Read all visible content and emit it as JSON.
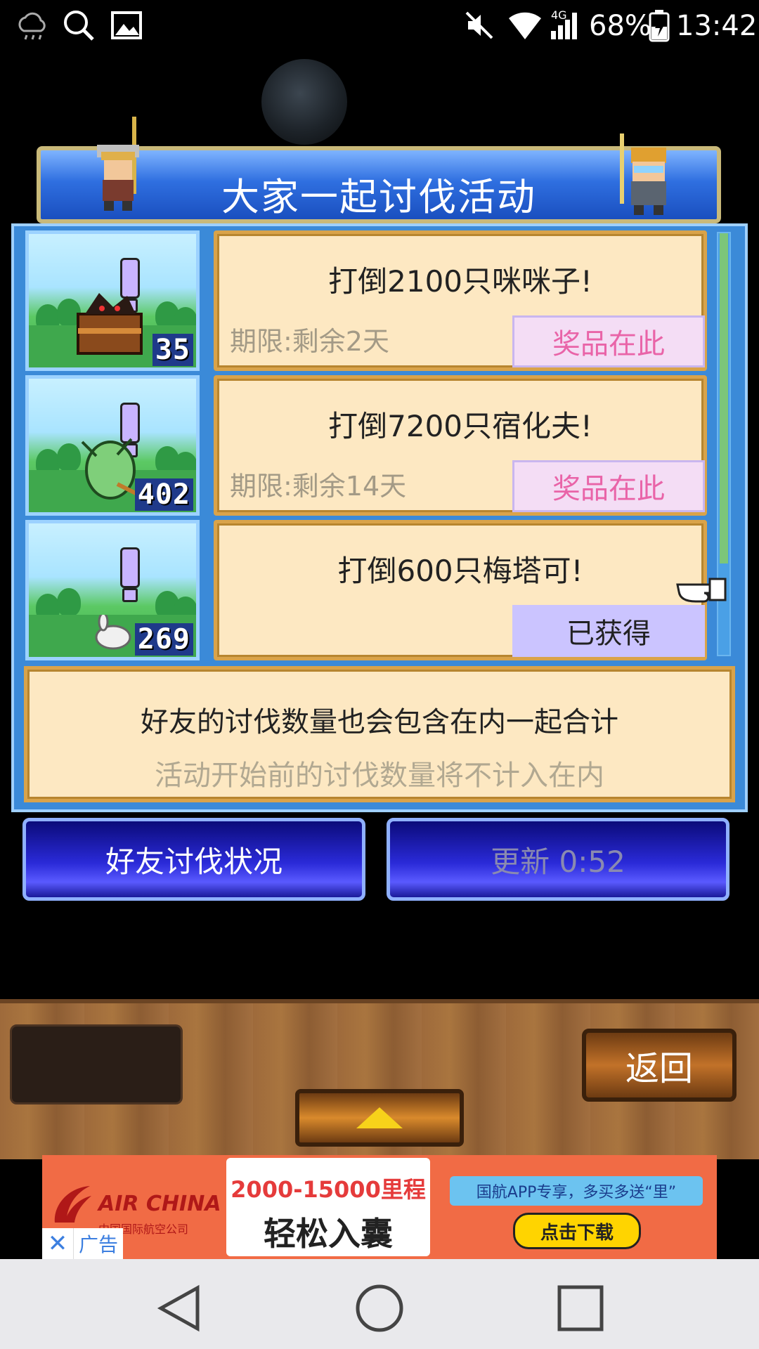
{
  "status_bar": {
    "battery": "68%",
    "time": "13:42",
    "network": "4G",
    "icons_left": [
      "cloud-icon",
      "search-icon",
      "image-icon"
    ],
    "icons_right": [
      "mute-icon",
      "wifi-icon",
      "signal-icon",
      "battery-icon"
    ]
  },
  "header": {
    "title": "大家一起讨伐活动"
  },
  "quests": [
    {
      "title": "打倒2100只咪咪子!",
      "deadline": "期限:剩余2天",
      "count": "35",
      "button": "奖品在此",
      "state": "available"
    },
    {
      "title": "打倒7200只宿化夫!",
      "deadline": "期限:剩余14天",
      "count": "402",
      "button": "奖品在此",
      "state": "available"
    },
    {
      "title": "打倒600只梅塔可!",
      "deadline": "",
      "count": "269",
      "button": "已获得",
      "state": "obtained"
    }
  ],
  "note": {
    "line1": "好友的讨伐数量也会包含在内一起合计",
    "line2": "活动开始前的讨伐数量将不计入在内"
  },
  "buttons": {
    "friends": "好友讨伐状况",
    "update": "更新 0:52",
    "back": "返回"
  },
  "ad": {
    "brand": "AIR CHINA",
    "brand_sub": "中国国际航空公司",
    "headline": "2000-15000里程",
    "subline": "轻松入囊",
    "promo": "国航APP专享，多买多送“里”",
    "download": "点击下载",
    "label": "广告",
    "close": "✕"
  },
  "colors": {
    "panel_blue": "#3b8ad8",
    "card_bg": "#fde8c2",
    "prize_text": "#e964a8",
    "obtained_bg": "#cbc4ff"
  }
}
